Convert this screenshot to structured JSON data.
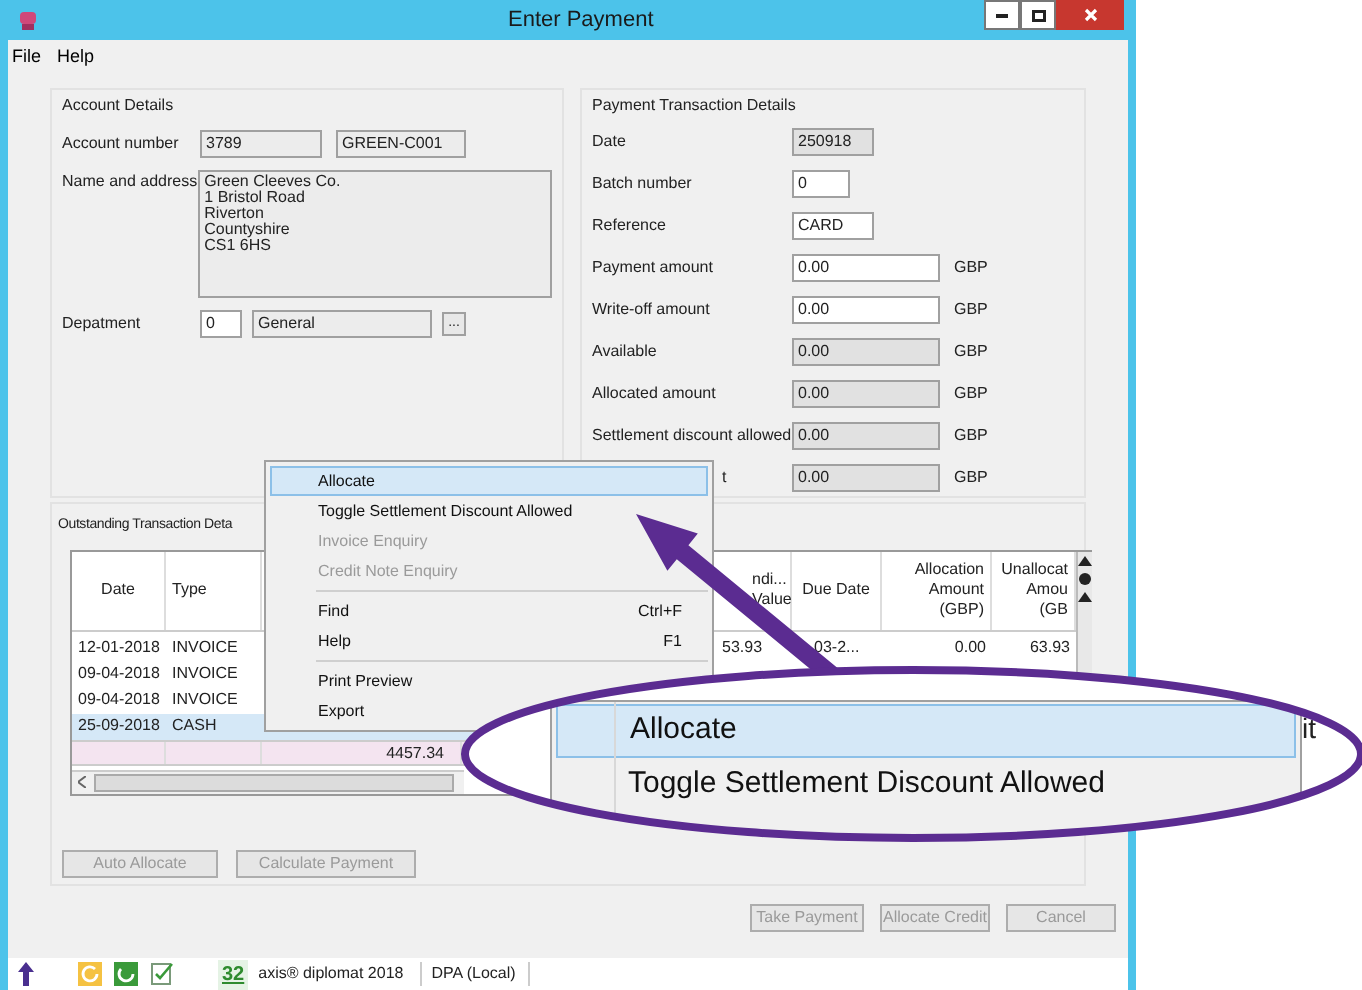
{
  "window": {
    "title": "Enter Payment"
  },
  "menu": [
    "File",
    "Help"
  ],
  "account_details": {
    "title": "Account Details",
    "account_number": {
      "label": "Account number",
      "value": "3789",
      "code": "GREEN-C001"
    },
    "name_and_address": {
      "label": "Name and address",
      "lines": [
        "Green Cleeves Co.",
        "1 Bristol Road",
        "Riverton",
        "Countyshire",
        "CS1 6HS"
      ]
    },
    "department": {
      "label": "Depatment",
      "code": "0",
      "name": "General",
      "browse": "..."
    }
  },
  "payment_details": {
    "title": "Payment Transaction Details",
    "rows": [
      {
        "label": "Date",
        "value": "250918",
        "kind": "code",
        "editable": false
      },
      {
        "label": "Batch number",
        "value": "0",
        "kind": "short",
        "editable": true
      },
      {
        "label": "Reference",
        "value": "CARD",
        "kind": "code",
        "editable": true
      },
      {
        "label": "Payment amount",
        "value": "0.00",
        "kind": "amount",
        "editable": true,
        "currency": "GBP"
      },
      {
        "label": "Write-off amount",
        "value": "0.00",
        "kind": "amount",
        "editable": true,
        "currency": "GBP"
      },
      {
        "label": "Available",
        "value": "0.00",
        "kind": "amount",
        "editable": false,
        "currency": "GBP"
      },
      {
        "label": "Allocated amount",
        "value": "0.00",
        "kind": "amount",
        "editable": false,
        "currency": "GBP"
      },
      {
        "label": "Settlement discount allowed",
        "value": "0.00",
        "kind": "amount",
        "editable": false,
        "currency": "GBP"
      },
      {
        "label": "t",
        "value": "0.00",
        "kind": "amount",
        "editable": false,
        "currency": "GBP"
      }
    ]
  },
  "outstanding": {
    "title": "Outstanding Transaction Deta",
    "columns": [
      {
        "header": [
          "Date"
        ]
      },
      {
        "header": [
          "Type"
        ]
      },
      {},
      {},
      {
        "header": [
          "ndi...",
          "Value"
        ]
      },
      {
        "header": [
          "Due Date"
        ]
      },
      {
        "header": [
          "Allocation",
          "Amount",
          "(GBP)"
        ]
      },
      {
        "header": [
          "Unallocat",
          "Amou",
          "(GB"
        ]
      }
    ],
    "rows": [
      {
        "cells": [
          "12-01-2018",
          "INVOICE",
          null,
          null,
          "53.93",
          "03-2...",
          "0.00",
          "63.93"
        ],
        "selected": false
      },
      {
        "cells": [
          "09-04-2018",
          "INVOICE"
        ],
        "selected": false
      },
      {
        "cells": [
          "09-04-2018",
          "INVOICE"
        ],
        "selected": false
      },
      {
        "cells": [
          "25-09-2018",
          "CASH"
        ],
        "selected": true
      }
    ],
    "totals": {
      "value": "4457.34"
    },
    "buttons": [
      {
        "label": "Auto Allocate",
        "disabled": true
      },
      {
        "label": "Calculate Payment",
        "disabled": true
      }
    ]
  },
  "buttons": [
    {
      "label": "Take Payment",
      "disabled": true
    },
    {
      "label": "Allocate Credit",
      "disabled": true
    },
    {
      "label": "Cancel",
      "disabled": true
    }
  ],
  "status_bar": {
    "count": "32",
    "product": "axis® diplomat 2018",
    "database": "DPA (Local)"
  },
  "context_menu": [
    {
      "kind": "item",
      "label": "Allocate",
      "selected": true,
      "disabled": false
    },
    {
      "kind": "item",
      "label": "Toggle Settlement Discount Allowed",
      "selected": false,
      "disabled": false
    },
    {
      "kind": "item",
      "label": "Invoice Enquiry",
      "selected": false,
      "disabled": true
    },
    {
      "kind": "item",
      "label": "Credit Note Enquiry",
      "selected": false,
      "disabled": true
    },
    {
      "kind": "separator"
    },
    {
      "kind": "item",
      "label": "Find",
      "shortcut": "Ctrl+F",
      "selected": false,
      "disabled": false
    },
    {
      "kind": "item",
      "label": "Help",
      "shortcut": "F1",
      "selected": false,
      "disabled": false
    },
    {
      "kind": "separator"
    },
    {
      "kind": "item",
      "label": "Print Preview",
      "selected": false,
      "disabled": false
    },
    {
      "kind": "item",
      "label": "Export",
      "selected": false,
      "disabled": false
    }
  ],
  "callout": {
    "items": [
      {
        "label": "Allocate",
        "selected": true
      },
      {
        "label": "Toggle Settlement Discount Allowed",
        "selected": false
      }
    ],
    "fragment": "it"
  }
}
